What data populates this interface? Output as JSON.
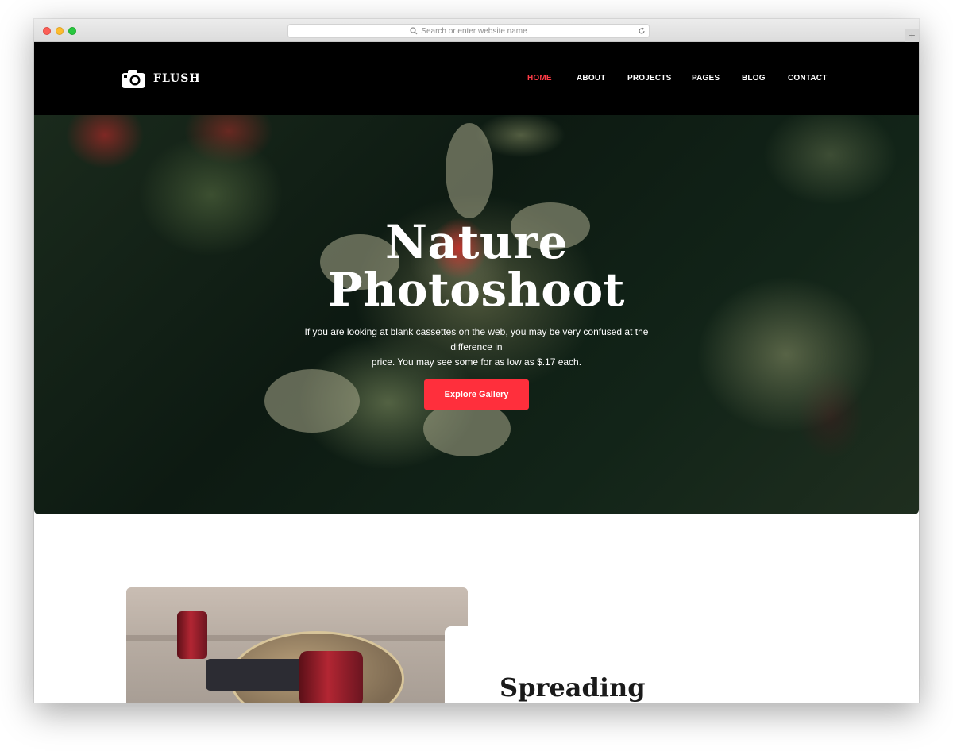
{
  "browser": {
    "url_placeholder": "Search or enter website name"
  },
  "site": {
    "brand": "FLUSH",
    "nav": [
      {
        "label": "HOME",
        "active": true
      },
      {
        "label": "ABOUT",
        "active": false
      },
      {
        "label": "PROJECTS",
        "active": false
      },
      {
        "label": "PAGES",
        "active": false
      },
      {
        "label": "BLOG",
        "active": false
      },
      {
        "label": "CONTACT",
        "active": false
      }
    ]
  },
  "hero": {
    "title_line1": "Nature",
    "title_line2": "Photoshoot",
    "subtitle_line1": "If you are looking at blank cassettes on the web, you may be very confused at the difference in",
    "subtitle_line2": "price. You may see some for as low as $.17 each.",
    "button_label": "Explore Gallery"
  },
  "section": {
    "title": "Spreading"
  },
  "colors": {
    "accent": "#ff2f3c",
    "header_bg": "#000000"
  }
}
